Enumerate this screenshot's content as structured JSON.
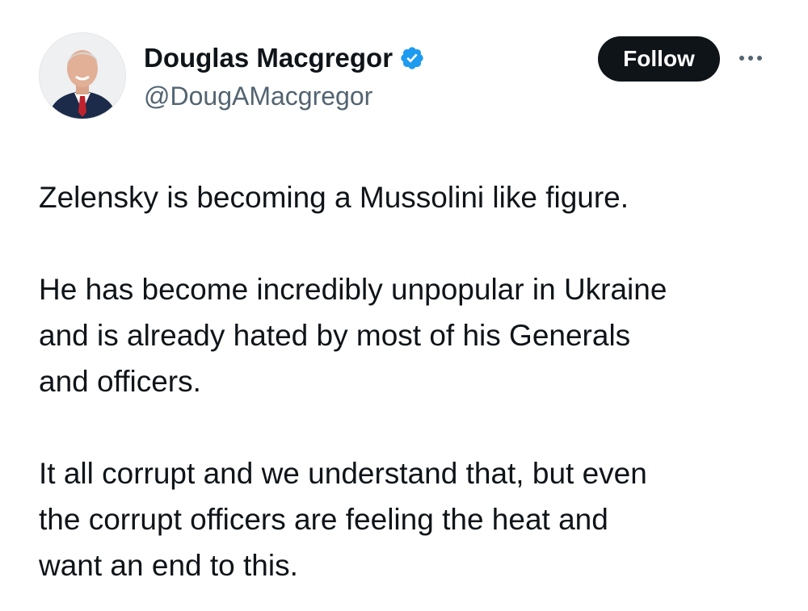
{
  "author": {
    "name": "Douglas Macgregor",
    "handle": "@DougAMacgregor",
    "verified_icon": "verified-badge-icon",
    "verified_color": "#1d9bf0",
    "avatar_icon": "profile-photo-avatar"
  },
  "actions": {
    "follow_label": "Follow",
    "more_icon": "more-options-icon"
  },
  "tweet": {
    "paragraphs": [
      {
        "lines": [
          "Zelensky is becoming a Mussolini like figure."
        ]
      },
      {
        "lines": [
          "He has become incredibly unpopular in Ukraine",
          "and is already hated by most of his Generals",
          "and officers."
        ]
      },
      {
        "lines": [
          "It all corrupt and we understand that, but even",
          "the corrupt officers are feeling the heat and",
          "want an end to this."
        ]
      }
    ]
  },
  "colors": {
    "text": "#0f1419",
    "secondary_text": "#536471",
    "button_bg": "#0f1419",
    "button_text": "#ffffff"
  }
}
